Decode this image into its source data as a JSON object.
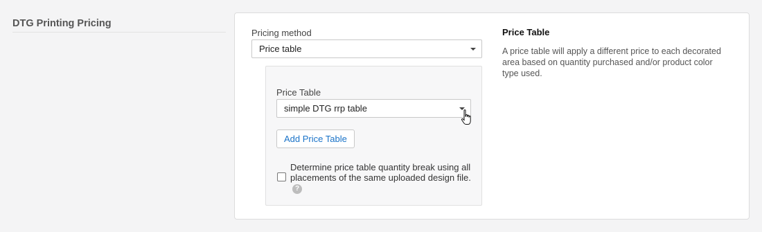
{
  "section": {
    "title": "DTG Printing Pricing"
  },
  "pricing_method": {
    "label": "Pricing method",
    "selected": "Price table"
  },
  "price_table": {
    "label": "Price Table",
    "selected": "simple DTG rrp table",
    "add_button": "Add Price Table",
    "checkbox_label": "Determine price table quantity break using all placements of the same uploaded design file.",
    "checkbox_checked": false,
    "help_icon": "?"
  },
  "info": {
    "title": "Price Table",
    "description": "A price table will apply a different price to each decorated area based on quantity purchased and/or product color type used."
  },
  "icons": {
    "dropdown": "caret-down-icon",
    "help": "question-circle-icon",
    "cursor": "hand-pointer-icon"
  },
  "colors": {
    "link_blue": "#1a73c8",
    "background": "#f4f4f5",
    "panel": "#f7f7f8"
  }
}
